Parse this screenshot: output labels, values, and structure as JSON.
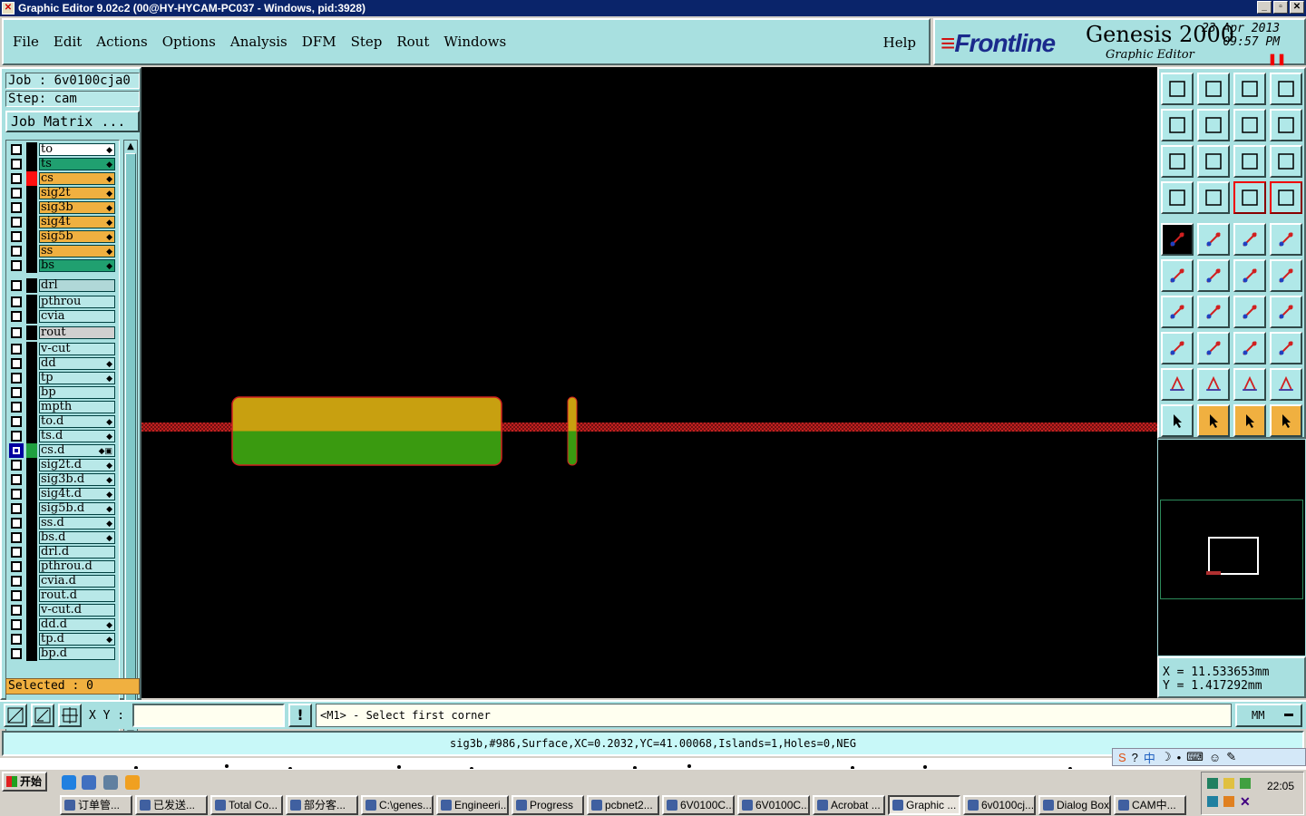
{
  "titlebar": {
    "title": "Graphic Editor 9.02c2 (00@HY-HYCAM-PC037 - Windows, pid:3928)"
  },
  "menu": {
    "items": [
      "File",
      "Edit",
      "Actions",
      "Options",
      "Analysis",
      "DFM",
      "Step",
      "Rout",
      "Windows"
    ],
    "help": "Help"
  },
  "brand": {
    "logo": "Frontline",
    "product": "Genesis 2000",
    "subtitle": "Graphic Editor",
    "date": "23 Apr 2013",
    "time": "09:57 PM"
  },
  "left": {
    "job": "Job : 6v0100cja0",
    "step": "Step: cam",
    "job_matrix": "Job Matrix ...",
    "selected": "Selected : 0"
  },
  "layers": [
    {
      "name": "to",
      "bg": "#ffffff",
      "color": "#000000",
      "mark": "◆"
    },
    {
      "name": "ts",
      "bg": "#20a070",
      "color": "#000000",
      "mark": "◆"
    },
    {
      "name": "cs",
      "bg": "#f0b040",
      "color": "#ff1010",
      "mark": "◆"
    },
    {
      "name": "sig2t",
      "bg": "#f0b040",
      "color": "#000000",
      "mark": "◆"
    },
    {
      "name": "sig3b",
      "bg": "#f0b040",
      "color": "#000000",
      "mark": "◆"
    },
    {
      "name": "sig4t",
      "bg": "#f0b040",
      "color": "#000000",
      "mark": "◆"
    },
    {
      "name": "sig5b",
      "bg": "#f0b040",
      "color": "#000000",
      "mark": "◆"
    },
    {
      "name": "ss",
      "bg": "#f0b040",
      "color": "#000000",
      "mark": "◆"
    },
    {
      "name": "bs",
      "bg": "#20a070",
      "color": "#000000",
      "mark": "◆"
    },
    {
      "name": "drl",
      "bg": "#b0d8d8",
      "color": "#000000",
      "mark": ""
    },
    {
      "name": "pthrou",
      "bg": "#b8e8e8",
      "color": "#000000",
      "mark": ""
    },
    {
      "name": "cvia",
      "bg": "#b8e8e8",
      "color": "#000000",
      "mark": ""
    },
    {
      "name": "rout",
      "bg": "#d0d0d0",
      "color": "#000000",
      "mark": ""
    },
    {
      "name": "v-cut",
      "bg": "#b8e8e8",
      "color": "#000000",
      "mark": ""
    },
    {
      "name": "dd",
      "bg": "#b8e8e8",
      "color": "#000000",
      "mark": "◆"
    },
    {
      "name": "tp",
      "bg": "#b8e8e8",
      "color": "#000000",
      "mark": "◆"
    },
    {
      "name": "bp",
      "bg": "#b8e8e8",
      "color": "#000000",
      "mark": ""
    },
    {
      "name": "mpth",
      "bg": "#b8e8e8",
      "color": "#000000",
      "mark": ""
    },
    {
      "name": "to.d",
      "bg": "#b8e8e8",
      "color": "#000000",
      "mark": "◆"
    },
    {
      "name": "ts.d",
      "bg": "#b8e8e8",
      "color": "#000000",
      "mark": "◆"
    },
    {
      "name": "cs.d",
      "bg": "#b8e8e8",
      "color": "#20a040",
      "mark": "◆▣",
      "selected": true
    },
    {
      "name": "sig2t.d",
      "bg": "#b8e8e8",
      "color": "#000000",
      "mark": "◆"
    },
    {
      "name": "sig3b.d",
      "bg": "#b8e8e8",
      "color": "#000000",
      "mark": "◆"
    },
    {
      "name": "sig4t.d",
      "bg": "#b8e8e8",
      "color": "#000000",
      "mark": "◆"
    },
    {
      "name": "sig5b.d",
      "bg": "#b8e8e8",
      "color": "#000000",
      "mark": "◆"
    },
    {
      "name": "ss.d",
      "bg": "#b8e8e8",
      "color": "#000000",
      "mark": "◆"
    },
    {
      "name": "bs.d",
      "bg": "#b8e8e8",
      "color": "#000000",
      "mark": "◆"
    },
    {
      "name": "drl.d",
      "bg": "#b8e8e8",
      "color": "#000000",
      "mark": ""
    },
    {
      "name": "pthrou.d",
      "bg": "#b8e8e8",
      "color": "#000000",
      "mark": ""
    },
    {
      "name": "cvia.d",
      "bg": "#b8e8e8",
      "color": "#000000",
      "mark": ""
    },
    {
      "name": "rout.d",
      "bg": "#b8e8e8",
      "color": "#000000",
      "mark": ""
    },
    {
      "name": "v-cut.d",
      "bg": "#b8e8e8",
      "color": "#000000",
      "mark": ""
    },
    {
      "name": "dd.d",
      "bg": "#b8e8e8",
      "color": "#000000",
      "mark": "◆"
    },
    {
      "name": "tp.d",
      "bg": "#b8e8e8",
      "color": "#000000",
      "mark": "◆"
    },
    {
      "name": "bp.d",
      "bg": "#b8e8e8",
      "color": "#000000",
      "mark": ""
    }
  ],
  "coords": {
    "x": "X = 11.533653mm",
    "y": "Y = 1.417292mm"
  },
  "command": {
    "xy_label": "X Y :",
    "xy_value": "",
    "prompt": "<M1> - Select first corner",
    "units": "MM"
  },
  "status": "sig3b,#986,Surface,XC=0.2032,YC=41.00068,Islands=1,Holes=0,NEG",
  "taskbar": {
    "start": "开始",
    "clock": "22:05",
    "tasks": [
      "订单管...",
      "已发送...",
      "Total Co...",
      "部分客...",
      "C:\\genes...",
      "Engineeri...",
      "Progress",
      "pcbnet2...",
      "6V0100C...",
      "6V0100C...",
      "Acrobat ...",
      "Graphic ...",
      "6v0100cj...",
      "Dialog Box",
      "CAM中..."
    ],
    "active_task": 11
  },
  "ime": {
    "label": "中"
  },
  "colors": {
    "canvas": "#000000",
    "panel": "#a8e0e0",
    "accent": "#f0b040",
    "trace": "#c02020",
    "pad_top": "#c8a010",
    "pad_bottom": "#3a9a10"
  }
}
